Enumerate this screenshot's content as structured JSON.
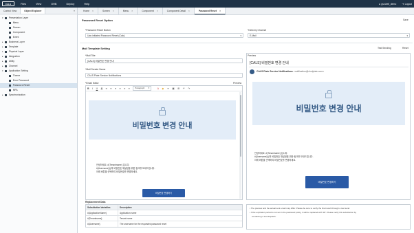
{
  "topbar": {
    "logo": "CALS",
    "menu": [
      "Files",
      "View",
      "OHB",
      "Deploy",
      "Help"
    ],
    "user": "gs.shell_demo",
    "logout": "Logout"
  },
  "sidebar": {
    "tabs": [
      "Control View",
      "Object Explorer"
    ],
    "close": "«",
    "tree": [
      {
        "label": "Presentation Layer",
        "level": 1,
        "open": true
      },
      {
        "label": "Menu",
        "level": 2
      },
      {
        "label": "Screen",
        "level": 2
      },
      {
        "label": "Component",
        "level": 2
      },
      {
        "label": "Event",
        "level": 2
      },
      {
        "label": "Business Layer",
        "level": 1
      },
      {
        "label": "Template",
        "level": 1
      },
      {
        "label": "Physical Layer",
        "level": 1
      },
      {
        "label": "Integration",
        "level": 1
      },
      {
        "label": "Utility",
        "level": 1
      },
      {
        "label": "Channel",
        "level": 1
      },
      {
        "label": "Application Setting",
        "level": 1,
        "open": true
      },
      {
        "label": "Theme",
        "level": 2
      },
      {
        "label": "Error Password",
        "level": 2
      },
      {
        "label": "Password Reset",
        "level": 2,
        "selected": true
      },
      {
        "label": "MFA",
        "level": 2
      },
      {
        "label": "Synchronization",
        "level": 1
      }
    ]
  },
  "tabs": [
    {
      "label": "Home",
      "active": false
    },
    {
      "label": "Screen",
      "active": false
    },
    {
      "label": "Menu",
      "active": false
    },
    {
      "label": "Component",
      "active": false
    },
    {
      "label": "Component Detail",
      "active": false
    },
    {
      "label": "Password Reset",
      "active": true
    }
  ],
  "option": {
    "title": "Password Reset Option",
    "save": "Save",
    "button_label": "*Password Reset Button",
    "button_value": "Use-initiated Password Reset (Calc)",
    "channel_label": "*Delivery Channel",
    "channel_value": "E-Mail"
  },
  "mail": {
    "title": "Mail Template Setting",
    "test_send": "Test Sending",
    "reset": "Reset",
    "mail_title_label": "*Mail Title",
    "mail_title_value": "[CALS] 비밀번호 변경 안내",
    "sender_label": "*Mail Sender Name",
    "sender_value": "CALS Plate Service Notifications",
    "editor_label": "*Email Editor",
    "preview_link": "Preview",
    "toolbar": [
      "B",
      "I",
      "U",
      "S",
      "≡",
      "≡",
      "≡",
      "≡",
      "≡",
      "≡"
    ],
    "paragraph": "Paragraph",
    "banner_title": "비밀번호 변경 안내",
    "body_lines": [
      "안녕하세요, #{Tenantname} 입니다.",
      "#{Username}님의 비밀번호 재설정을 위한 링크를 보내드립니다.",
      "아래 버튼을 선택하여 비밀번호를 변경하세요."
    ],
    "button_text": "비밀번호 변경하기"
  },
  "preview": {
    "label": "Preview",
    "subject": "[CALS] 비밀번호 변경 안내",
    "sender_name": "CALS Plate Service Notifications",
    "sender_email": "<notification@cholplate.com>",
    "banner_title": "비밀번호 변경 안내",
    "body_lines": [
      "안녕하세요, #{Tenantname} 입니다.",
      "#{Username}님의 비밀번호 재설정을 위한 링크를 보내드립니다.",
      "아래 버튼을 선택하여 비밀번호를 변경하세요."
    ],
    "button_text": "비밀번호 변경하기"
  },
  "replacement": {
    "title": "Replacement Data",
    "headers": [
      "Substitution Variables",
      "Description"
    ],
    "rows": [
      [
        "#{ApplicationName}",
        "Application name"
      ],
      [
        "#{Tenantname}",
        "Tenant name"
      ],
      [
        "#{Username}",
        "The username for the requested password reset"
      ]
    ]
  },
  "notes": [
    "The preview and the actual sent email may differ. Please be sure to verify the final result through a test send.",
    "If the expiration period is not set in the password policy, it will be replaced with '30'. Please verify this substitution by",
    "conducting a test dispatch."
  ],
  "colors": {
    "topbar": "#1f3347",
    "accent": "#2a5aa6",
    "banner": "#e3edf8"
  }
}
